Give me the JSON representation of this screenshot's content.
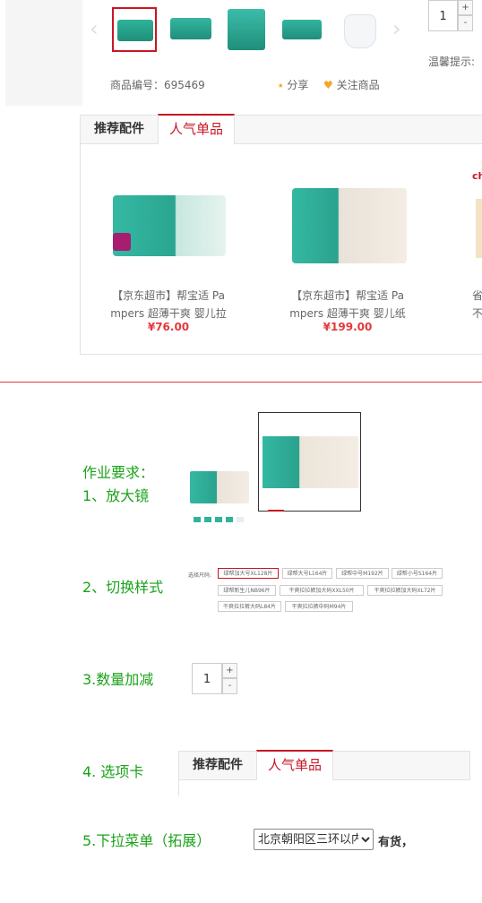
{
  "gallery": {
    "thumbnails": [
      "thumb-pack-green",
      "thumb-pack-green",
      "thumb-box-teal",
      "thumb-pack-green",
      "thumb-diaper-white"
    ],
    "prev_icon": "chevron-left-icon",
    "next_icon": "chevron-right-icon"
  },
  "purchase": {
    "quantity": "1",
    "plus": "+",
    "minus": "-",
    "hint": "温馨提示:"
  },
  "product_meta": {
    "sku_label": "商品编号：695469",
    "share_label": "分享",
    "follow_label": "关注商品"
  },
  "recommend": {
    "tabs": [
      "推荐配件",
      "人气单品"
    ],
    "active_tab": 1,
    "items": [
      {
        "name_line1": "【京东超市】帮宝适 Pa",
        "name_line2": "mpers 超薄干爽 婴儿拉",
        "price": "¥76.00"
      },
      {
        "name_line1": "【京东超市】帮宝适 Pa",
        "name_line2": "mpers 超薄干爽 婴儿纸",
        "price": "¥199.00"
      },
      {
        "name_line1": "省",
        "name_line2": "不",
        "price": ""
      }
    ],
    "edge_text": "ch"
  },
  "assignment": {
    "title": "作业要求：",
    "item1": "1、放大镜",
    "item2": "2、切换样式",
    "item3": "3.数量加减",
    "item4": "4. 选项卡",
    "item5": "5.下拉菜单（拓展）"
  },
  "style_switch": {
    "label": "选择尺码:",
    "options": [
      "绿帮加大号XL128片",
      "绿帮大号L164片",
      "绿帮中号M192片",
      "绿帮小号S164片",
      "绿帮新生儿NB96片",
      "干爽拉拉裤加大码XXL50片",
      "干爽拉拉裤加大码XL72片",
      "干爽拉拉裤大码L84片",
      "干爽拉拉裤中码M94片"
    ],
    "selected": 0
  },
  "qty_demo": {
    "value": "1",
    "plus": "+",
    "minus": "-"
  },
  "tabs_demo": {
    "tabs": [
      "推荐配件",
      "人气单品"
    ],
    "active_tab": 1
  },
  "dropdown_demo": {
    "selected": "北京朝阳区三环以内",
    "stock": "有货，"
  },
  "colors": {
    "accent": "#c81623",
    "price": "#e4393c",
    "green": "#1aa31a",
    "follow_heart": "#f5a623",
    "share": "#f5a623"
  }
}
